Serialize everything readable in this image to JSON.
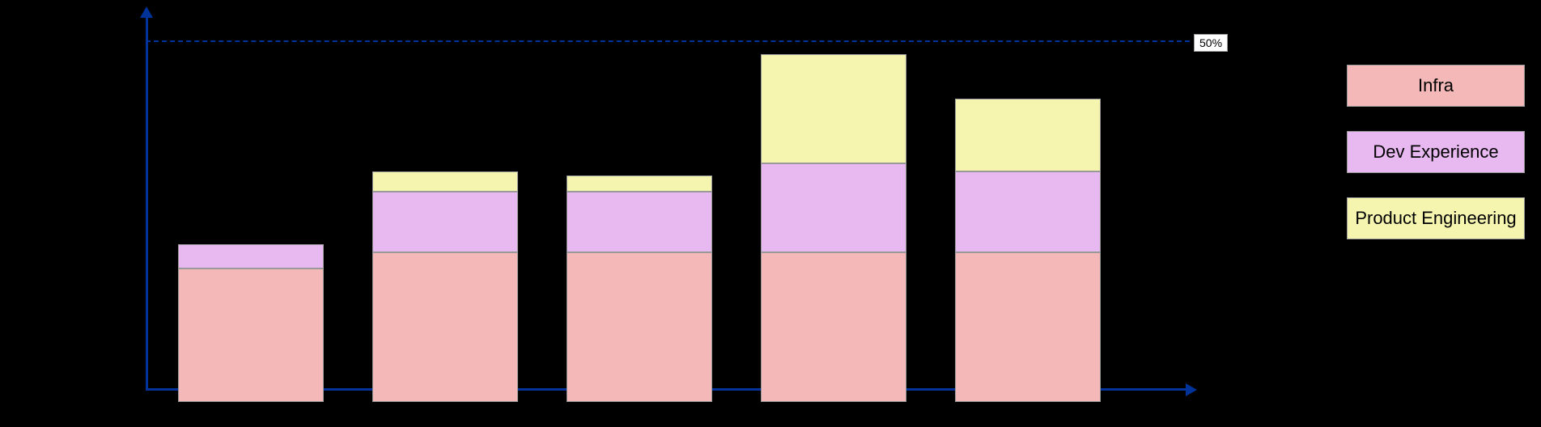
{
  "chart": {
    "background": "#000000",
    "referenceLineLabel": "50%",
    "bars": [
      {
        "id": "bar1",
        "segments": {
          "infra_height": 165,
          "devexp_height": 30,
          "product_height": 0
        }
      },
      {
        "id": "bar2",
        "segments": {
          "infra_height": 185,
          "devexp_height": 75,
          "product_height": 25
        }
      },
      {
        "id": "bar3",
        "segments": {
          "infra_height": 185,
          "devexp_height": 75,
          "product_height": 20
        }
      },
      {
        "id": "bar4",
        "segments": {
          "infra_height": 185,
          "devexp_height": 110,
          "product_height": 135
        }
      },
      {
        "id": "bar5",
        "segments": {
          "infra_height": 185,
          "devexp_height": 100,
          "product_height": 90
        }
      }
    ],
    "legend": {
      "items": [
        {
          "id": "infra",
          "label": "Infra",
          "color": "#f5b8b8"
        },
        {
          "id": "devexp",
          "label": "Dev Experience",
          "color": "#e8b8f0"
        },
        {
          "id": "product",
          "label": "Product Engineering",
          "color": "#f5f5b0"
        }
      ]
    }
  }
}
